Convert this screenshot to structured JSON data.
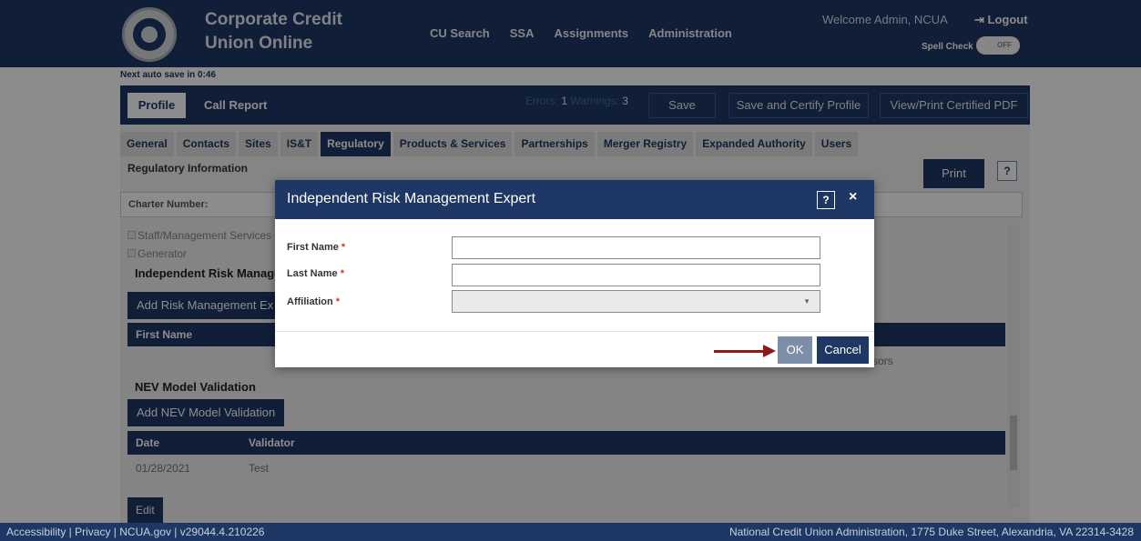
{
  "header": {
    "brand_line1": "Corporate Credit",
    "brand_line2": "Union Online",
    "nav": [
      "CU Search",
      "SSA",
      "Assignments",
      "Administration"
    ],
    "welcome": "Welcome Admin, NCUA",
    "logout": "Logout",
    "spellcheck_label": "Spell Check",
    "spellcheck_state": "OFF"
  },
  "autosave": "Next auto save in 0:46",
  "profilebar": {
    "tab_profile": "Profile",
    "tab_callreport": "Call Report",
    "errors_label": "Errors:",
    "errors_count": "1",
    "warnings_label": "Warnings:",
    "warnings_count": "3",
    "save": "Save",
    "save_certify": "Save and Certify Profile",
    "view_print": "View/Print Certified PDF"
  },
  "subtabs": [
    "General",
    "Contacts",
    "Sites",
    "IS&T",
    "Regulatory",
    "Products & Services",
    "Partnerships",
    "Merger Registry",
    "Expanded Authority",
    "Users"
  ],
  "regulatory": {
    "title": "Regulatory Information",
    "print": "Print",
    "help": "?",
    "charter_label": "Charter Number:",
    "checkboxes": [
      "Staff/Management Services",
      "Generator"
    ],
    "risk_header": "Independent Risk Manager",
    "add_risk_button": "Add Risk Management Ex",
    "risk_table_col1": "First Name",
    "risk_row_tail": "sors",
    "nev_header": "NEV Model Validation",
    "add_nev_button": "Add NEV Model Validation",
    "nev_table_cols": [
      "Date",
      "Validator"
    ],
    "nev_rows": [
      {
        "date": "01/28/2021",
        "validator": "Test"
      }
    ],
    "edit": "Edit"
  },
  "modal": {
    "title": "Independent Risk Management Expert",
    "help": "?",
    "close": "×",
    "first_name_label": "First Name",
    "last_name_label": "Last Name",
    "affiliation_label": "Affiliation",
    "required_mark": "*",
    "first_name_value": "",
    "last_name_value": "",
    "affiliation_value": "",
    "ok": "OK",
    "cancel": "Cancel"
  },
  "footer": {
    "left": "Accessibility | Privacy | NCUA.gov | v29044.4.210226",
    "right": "National Credit Union Administration, 1775 Duke Street, Alexandria, VA 22314-3428"
  },
  "colors": {
    "primary": "#1f3764",
    "required": "#d9342b",
    "annotation_arrow": "#8b1a1d"
  }
}
